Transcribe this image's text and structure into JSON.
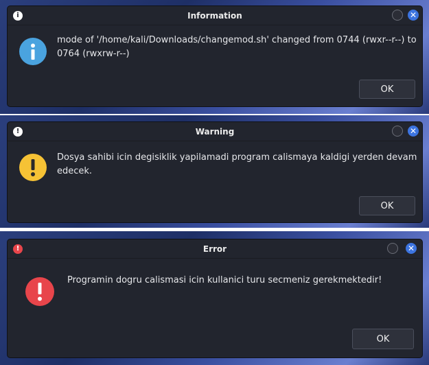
{
  "dialogs": [
    {
      "title": "Information",
      "message": "mode of '/home/kali/Downloads/changemod.sh' changed from 0744 (rwxr--r--) to 0764 (rwxrw-r--)",
      "ok_label": "OK",
      "icon": "info-icon",
      "icon_color": "#4aa3df"
    },
    {
      "title": "Warning",
      "message": "Dosya sahibi icin degisiklik yapilamadi program calismaya kaldigi yerden devam edecek.",
      "ok_label": "OK",
      "icon": "warning-icon",
      "icon_color": "#f6c235"
    },
    {
      "title": "Error",
      "message": "Programin dogru calismasi icin  kullanici turu secmeniz gerekmektedir!",
      "ok_label": "OK",
      "icon": "error-icon",
      "icon_color": "#e8454b"
    }
  ],
  "window_controls": {
    "close_glyph": "✕"
  }
}
